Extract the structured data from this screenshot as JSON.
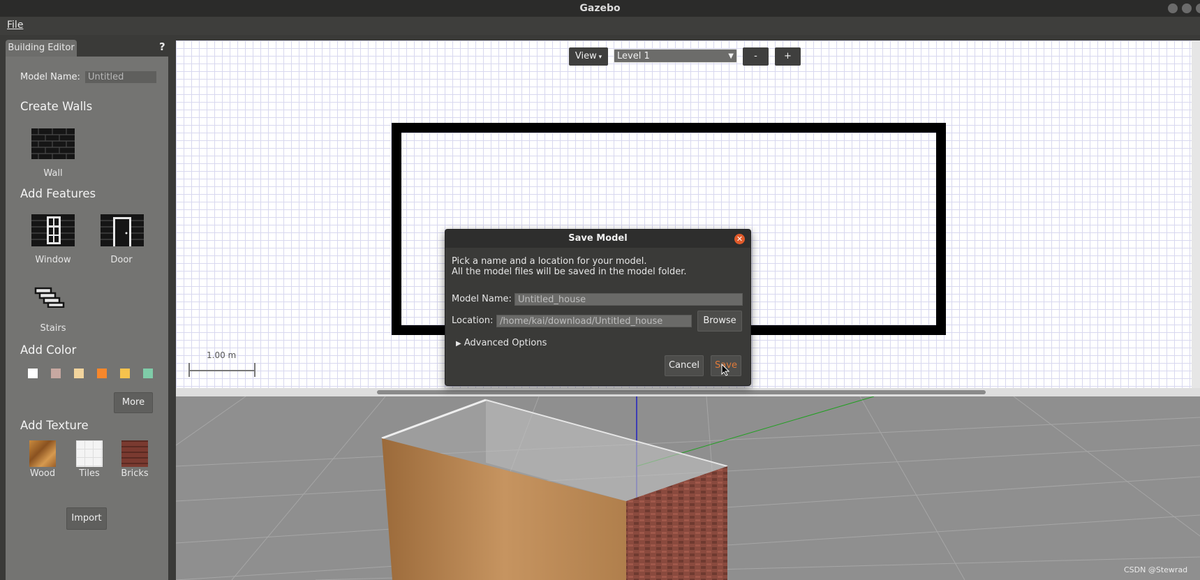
{
  "window": {
    "title": "Gazebo"
  },
  "menu": {
    "file": "File"
  },
  "sidebar": {
    "tab_label": "Building Editor",
    "help": "?",
    "model_name_label": "Model Name:",
    "model_name_value": "Untitled",
    "create_walls": "Create Walls",
    "wall": "Wall",
    "add_features": "Add Features",
    "window": "Window",
    "door": "Door",
    "stairs": "Stairs",
    "add_color": "Add Color",
    "colors": [
      "#ffffff",
      "#c7a8a1",
      "#f1d49d",
      "#f7872b",
      "#f6c24d",
      "#7fcca8"
    ],
    "more": "More",
    "add_texture": "Add Texture",
    "wood": "Wood",
    "tiles": "Tiles",
    "bricks": "Bricks",
    "import": "Import"
  },
  "toolbar": {
    "view": "View",
    "level": "Level 1",
    "minus": "-",
    "plus": "+"
  },
  "scale": {
    "label": "1.00 m"
  },
  "dialog": {
    "title": "Save Model",
    "line1": "Pick a name and a location for your model.",
    "line2": "All the model files will be saved in the model folder.",
    "model_name_label": "Model Name:",
    "model_name_value": "Untitled_house",
    "location_label": "Location:",
    "location_value": "/home/kai/download/Untitled_house",
    "browse": "Browse",
    "advanced": "Advanced Options",
    "cancel": "Cancel",
    "save": "Save"
  },
  "watermark": "CSDN @Stewrad"
}
